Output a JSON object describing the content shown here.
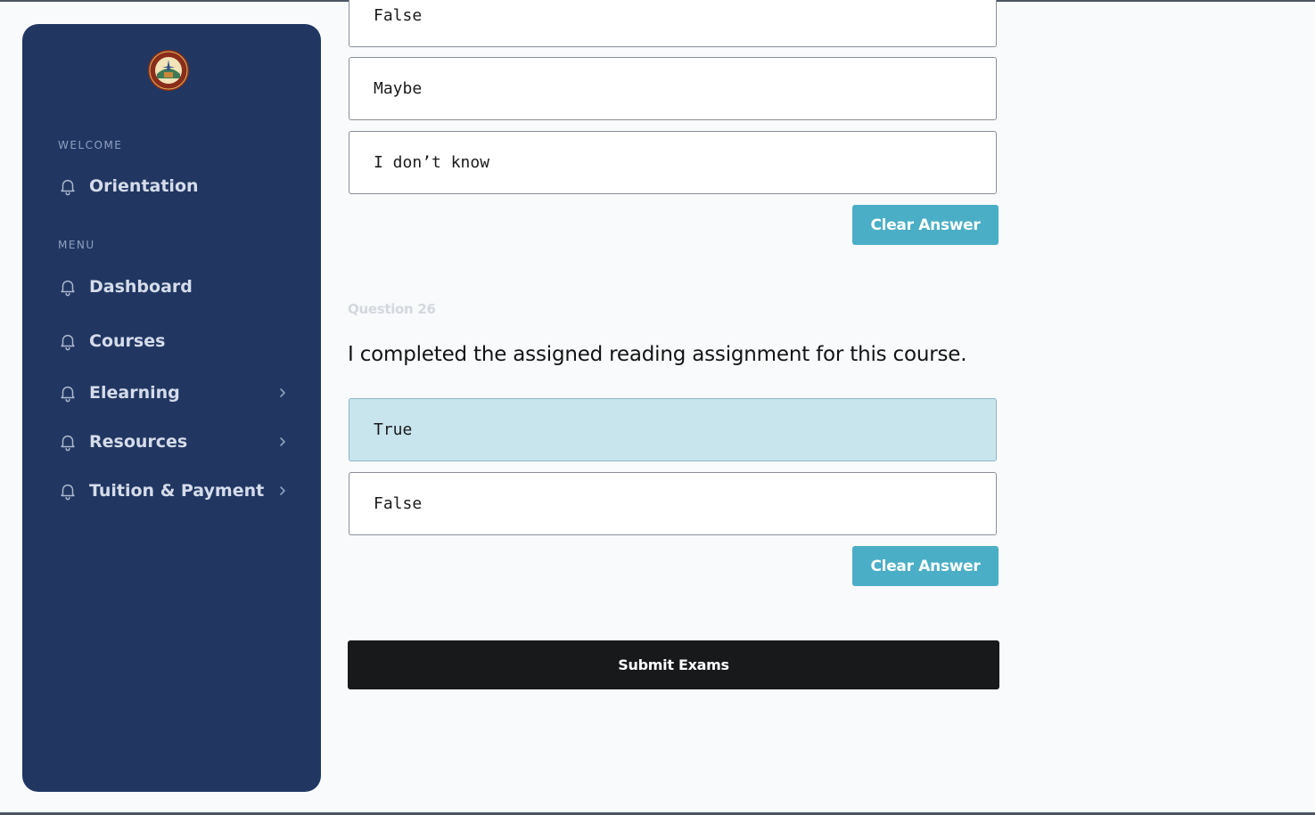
{
  "sidebar": {
    "logo_icon": "school-seal-logo",
    "welcome_label": "WELCOME",
    "orientation_label": "Orientation",
    "menu_label": "MENU",
    "items": [
      {
        "label": "Dashboard",
        "icon": "bell-icon",
        "has_submenu": false
      },
      {
        "label": "Courses",
        "icon": "bell-icon",
        "has_submenu": false
      },
      {
        "label": "Elearning",
        "icon": "bell-icon",
        "has_submenu": true
      },
      {
        "label": "Resources",
        "icon": "bell-icon",
        "has_submenu": true
      },
      {
        "label": "Tuition & Payment",
        "icon": "bell-icon",
        "has_submenu": true
      }
    ]
  },
  "question25": {
    "options": [
      "False",
      "Maybe",
      "I don’t know"
    ],
    "clear_label": "Clear Answer"
  },
  "question26": {
    "number_label": "Question 26",
    "text": "I completed the assigned reading assignment for this course.",
    "options": [
      "True",
      "False"
    ],
    "selected_option": "True",
    "clear_label": "Clear Answer"
  },
  "submit_label": "Submit Exams",
  "colors": {
    "sidebar_bg": "#213762",
    "accent": "#4aaec6",
    "selected_option_bg": "#c8e5ee",
    "submit_bg": "#18191b"
  }
}
